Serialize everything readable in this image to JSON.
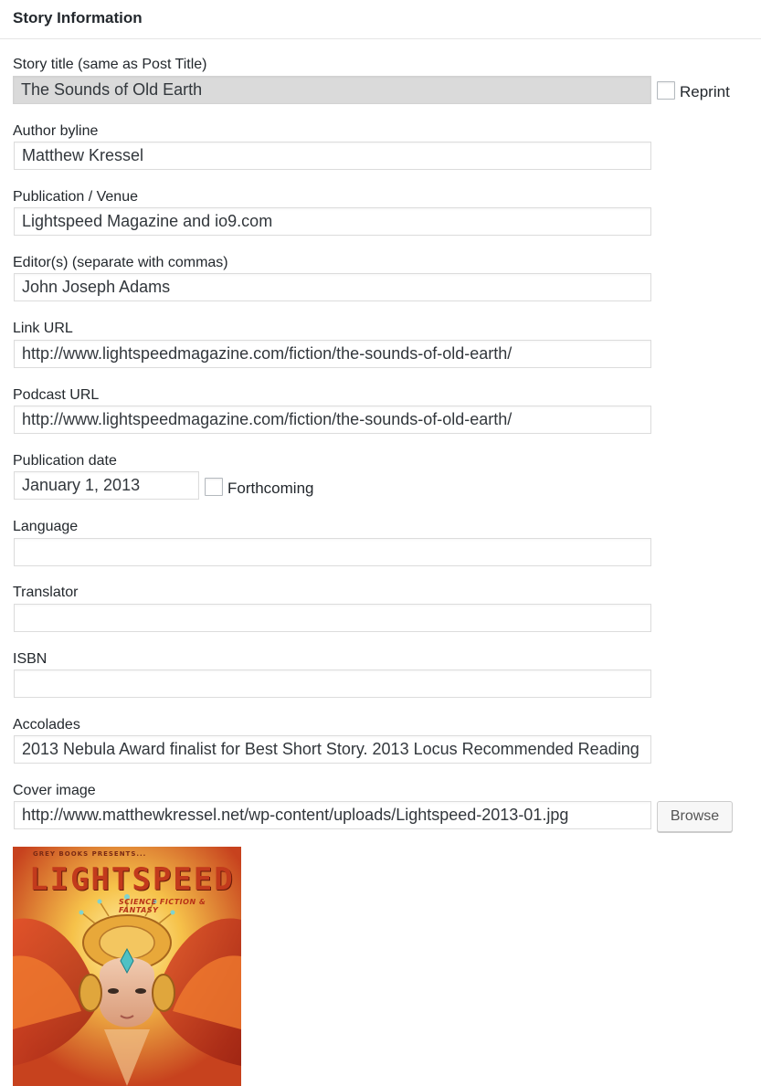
{
  "panel": {
    "title": "Story Information"
  },
  "fields": {
    "story_title": {
      "label": "Story title (same as Post Title)",
      "value": "The Sounds of Old Earth",
      "reprint_label": "Reprint"
    },
    "author": {
      "label": "Author byline",
      "value": "Matthew Kressel"
    },
    "publication": {
      "label": "Publication / Venue",
      "value": "Lightspeed Magazine and io9.com"
    },
    "editors": {
      "label": "Editor(s) (separate with commas)",
      "value": "John Joseph Adams"
    },
    "link_url": {
      "label": "Link URL",
      "value": "http://www.lightspeedmagazine.com/fiction/the-sounds-of-old-earth/"
    },
    "podcast_url": {
      "label": "Podcast URL",
      "value": "http://www.lightspeedmagazine.com/fiction/the-sounds-of-old-earth/"
    },
    "publication_date": {
      "label": "Publication date",
      "value": "January 1, 2013",
      "forthcoming_label": "Forthcoming"
    },
    "language": {
      "label": "Language",
      "value": ""
    },
    "translator": {
      "label": "Translator",
      "value": ""
    },
    "isbn": {
      "label": "ISBN",
      "value": ""
    },
    "accolades": {
      "label": "Accolades",
      "value": "2013 Nebula Award finalist for Best Short Story. 2013 Locus Recommended Reading"
    },
    "cover_image": {
      "label": "Cover image",
      "value": "http://www.matthewkressel.net/wp-content/uploads/Lightspeed-2013-01.jpg",
      "browse_label": "Browse"
    }
  },
  "cover": {
    "presents_text": "GREY BOOKS PRESENTS...",
    "masthead": "LIGHTSPEED",
    "tagline": "SCIENCE FICTION & FANTASY"
  }
}
